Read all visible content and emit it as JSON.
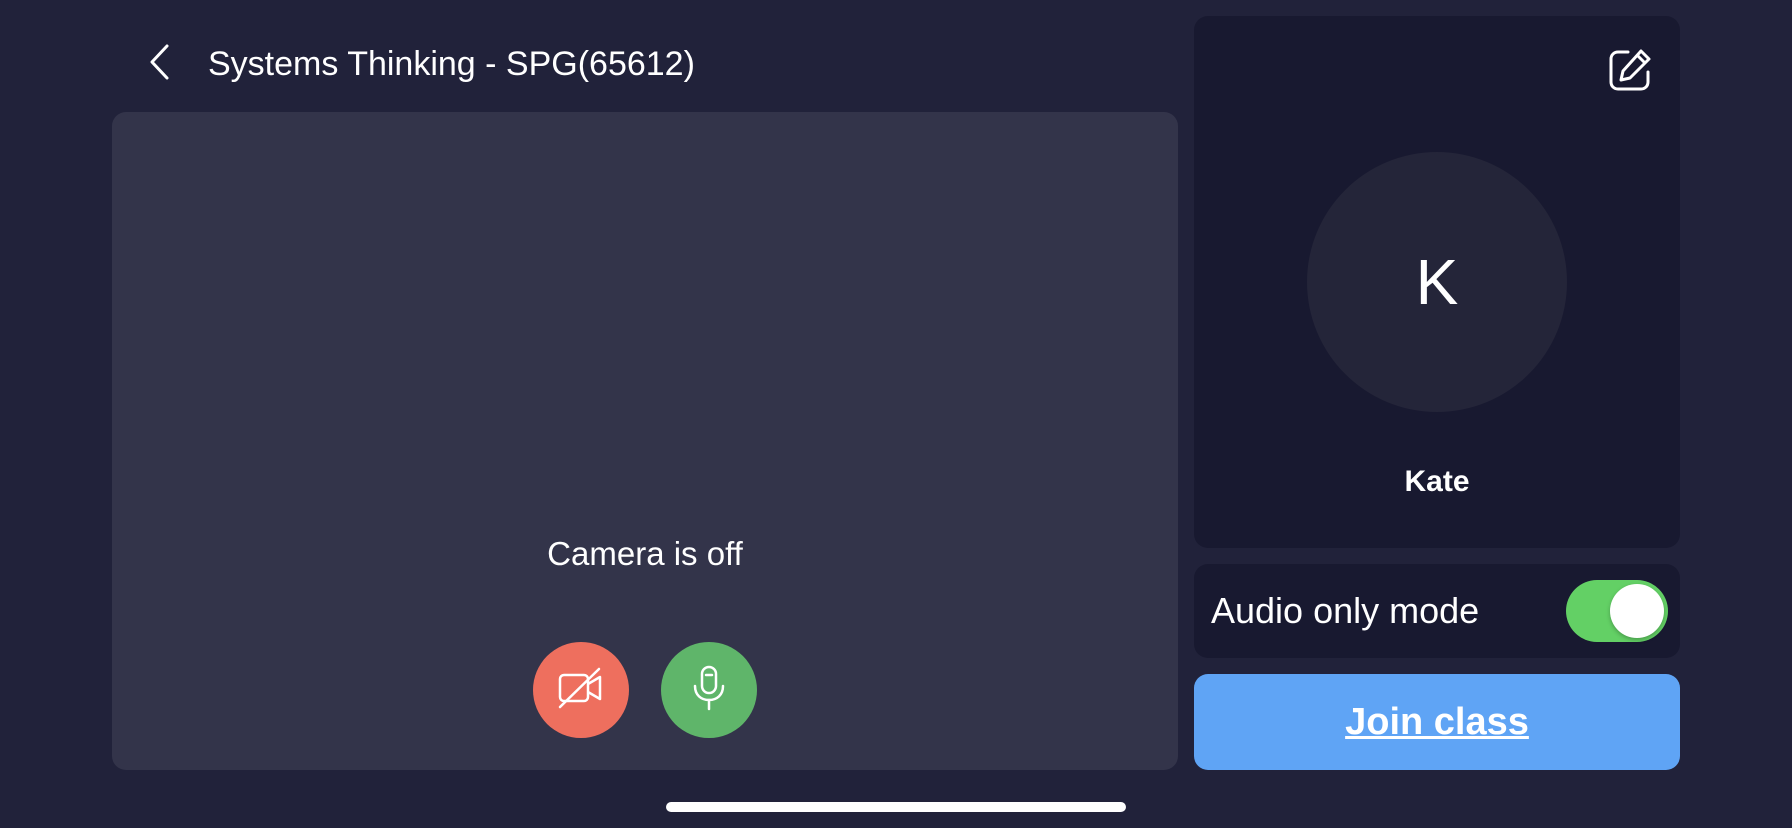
{
  "header": {
    "back_icon": "chevron-left-icon",
    "title": "Systems Thinking - SPG(65612)"
  },
  "preview": {
    "camera_status": "Camera is off",
    "camera_button_icon": "camera-off-icon",
    "mic_button_icon": "microphone-icon",
    "camera_button_color": "#ee6f5e",
    "mic_button_color": "#5fb56a"
  },
  "profile": {
    "edit_icon": "edit-icon",
    "avatar_initial": "K",
    "name": "Kate"
  },
  "audio_only": {
    "label": "Audio only mode",
    "enabled": true,
    "toggle_color": "#63d065"
  },
  "join": {
    "label": "Join class",
    "color": "#5fa4f5"
  }
}
